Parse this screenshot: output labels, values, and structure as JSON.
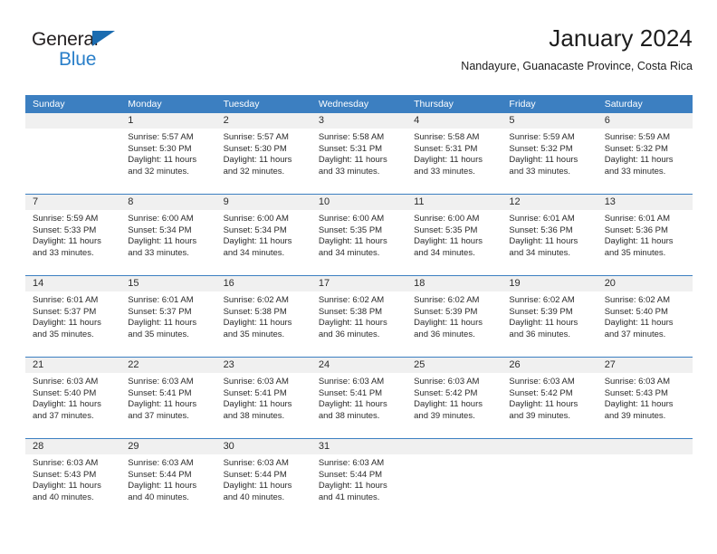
{
  "brand": {
    "name_top": "General",
    "name_bottom": "Blue",
    "triangle_color": "#1b6cb0",
    "text_color": "#231f20",
    "blue_text_color": "#2a7fc9"
  },
  "header": {
    "title": "January 2024",
    "subtitle": "Nandayure, Guanacaste Province, Costa Rica"
  },
  "theme": {
    "header_blue": "#3c7fc1",
    "daynum_band": "#f0f0f0",
    "text": "#2b2b2b",
    "page_background": "#ffffff"
  },
  "calendar": {
    "day_headers": [
      "Sunday",
      "Monday",
      "Tuesday",
      "Wednesday",
      "Thursday",
      "Friday",
      "Saturday"
    ],
    "weeks": [
      [
        {
          "day": "",
          "sunrise": "",
          "sunset": "",
          "daylight_line1": "",
          "daylight_line2": "",
          "empty": true
        },
        {
          "day": "1",
          "sunrise": "Sunrise: 5:57 AM",
          "sunset": "Sunset: 5:30 PM",
          "daylight_line1": "Daylight: 11 hours",
          "daylight_line2": "and 32 minutes."
        },
        {
          "day": "2",
          "sunrise": "Sunrise: 5:57 AM",
          "sunset": "Sunset: 5:30 PM",
          "daylight_line1": "Daylight: 11 hours",
          "daylight_line2": "and 32 minutes."
        },
        {
          "day": "3",
          "sunrise": "Sunrise: 5:58 AM",
          "sunset": "Sunset: 5:31 PM",
          "daylight_line1": "Daylight: 11 hours",
          "daylight_line2": "and 33 minutes."
        },
        {
          "day": "4",
          "sunrise": "Sunrise: 5:58 AM",
          "sunset": "Sunset: 5:31 PM",
          "daylight_line1": "Daylight: 11 hours",
          "daylight_line2": "and 33 minutes."
        },
        {
          "day": "5",
          "sunrise": "Sunrise: 5:59 AM",
          "sunset": "Sunset: 5:32 PM",
          "daylight_line1": "Daylight: 11 hours",
          "daylight_line2": "and 33 minutes."
        },
        {
          "day": "6",
          "sunrise": "Sunrise: 5:59 AM",
          "sunset": "Sunset: 5:32 PM",
          "daylight_line1": "Daylight: 11 hours",
          "daylight_line2": "and 33 minutes."
        }
      ],
      [
        {
          "day": "7",
          "sunrise": "Sunrise: 5:59 AM",
          "sunset": "Sunset: 5:33 PM",
          "daylight_line1": "Daylight: 11 hours",
          "daylight_line2": "and 33 minutes."
        },
        {
          "day": "8",
          "sunrise": "Sunrise: 6:00 AM",
          "sunset": "Sunset: 5:34 PM",
          "daylight_line1": "Daylight: 11 hours",
          "daylight_line2": "and 33 minutes."
        },
        {
          "day": "9",
          "sunrise": "Sunrise: 6:00 AM",
          "sunset": "Sunset: 5:34 PM",
          "daylight_line1": "Daylight: 11 hours",
          "daylight_line2": "and 34 minutes."
        },
        {
          "day": "10",
          "sunrise": "Sunrise: 6:00 AM",
          "sunset": "Sunset: 5:35 PM",
          "daylight_line1": "Daylight: 11 hours",
          "daylight_line2": "and 34 minutes."
        },
        {
          "day": "11",
          "sunrise": "Sunrise: 6:00 AM",
          "sunset": "Sunset: 5:35 PM",
          "daylight_line1": "Daylight: 11 hours",
          "daylight_line2": "and 34 minutes."
        },
        {
          "day": "12",
          "sunrise": "Sunrise: 6:01 AM",
          "sunset": "Sunset: 5:36 PM",
          "daylight_line1": "Daylight: 11 hours",
          "daylight_line2": "and 34 minutes."
        },
        {
          "day": "13",
          "sunrise": "Sunrise: 6:01 AM",
          "sunset": "Sunset: 5:36 PM",
          "daylight_line1": "Daylight: 11 hours",
          "daylight_line2": "and 35 minutes."
        }
      ],
      [
        {
          "day": "14",
          "sunrise": "Sunrise: 6:01 AM",
          "sunset": "Sunset: 5:37 PM",
          "daylight_line1": "Daylight: 11 hours",
          "daylight_line2": "and 35 minutes."
        },
        {
          "day": "15",
          "sunrise": "Sunrise: 6:01 AM",
          "sunset": "Sunset: 5:37 PM",
          "daylight_line1": "Daylight: 11 hours",
          "daylight_line2": "and 35 minutes."
        },
        {
          "day": "16",
          "sunrise": "Sunrise: 6:02 AM",
          "sunset": "Sunset: 5:38 PM",
          "daylight_line1": "Daylight: 11 hours",
          "daylight_line2": "and 35 minutes."
        },
        {
          "day": "17",
          "sunrise": "Sunrise: 6:02 AM",
          "sunset": "Sunset: 5:38 PM",
          "daylight_line1": "Daylight: 11 hours",
          "daylight_line2": "and 36 minutes."
        },
        {
          "day": "18",
          "sunrise": "Sunrise: 6:02 AM",
          "sunset": "Sunset: 5:39 PM",
          "daylight_line1": "Daylight: 11 hours",
          "daylight_line2": "and 36 minutes."
        },
        {
          "day": "19",
          "sunrise": "Sunrise: 6:02 AM",
          "sunset": "Sunset: 5:39 PM",
          "daylight_line1": "Daylight: 11 hours",
          "daylight_line2": "and 36 minutes."
        },
        {
          "day": "20",
          "sunrise": "Sunrise: 6:02 AM",
          "sunset": "Sunset: 5:40 PM",
          "daylight_line1": "Daylight: 11 hours",
          "daylight_line2": "and 37 minutes."
        }
      ],
      [
        {
          "day": "21",
          "sunrise": "Sunrise: 6:03 AM",
          "sunset": "Sunset: 5:40 PM",
          "daylight_line1": "Daylight: 11 hours",
          "daylight_line2": "and 37 minutes."
        },
        {
          "day": "22",
          "sunrise": "Sunrise: 6:03 AM",
          "sunset": "Sunset: 5:41 PM",
          "daylight_line1": "Daylight: 11 hours",
          "daylight_line2": "and 37 minutes."
        },
        {
          "day": "23",
          "sunrise": "Sunrise: 6:03 AM",
          "sunset": "Sunset: 5:41 PM",
          "daylight_line1": "Daylight: 11 hours",
          "daylight_line2": "and 38 minutes."
        },
        {
          "day": "24",
          "sunrise": "Sunrise: 6:03 AM",
          "sunset": "Sunset: 5:41 PM",
          "daylight_line1": "Daylight: 11 hours",
          "daylight_line2": "and 38 minutes."
        },
        {
          "day": "25",
          "sunrise": "Sunrise: 6:03 AM",
          "sunset": "Sunset: 5:42 PM",
          "daylight_line1": "Daylight: 11 hours",
          "daylight_line2": "and 39 minutes."
        },
        {
          "day": "26",
          "sunrise": "Sunrise: 6:03 AM",
          "sunset": "Sunset: 5:42 PM",
          "daylight_line1": "Daylight: 11 hours",
          "daylight_line2": "and 39 minutes."
        },
        {
          "day": "27",
          "sunrise": "Sunrise: 6:03 AM",
          "sunset": "Sunset: 5:43 PM",
          "daylight_line1": "Daylight: 11 hours",
          "daylight_line2": "and 39 minutes."
        }
      ],
      [
        {
          "day": "28",
          "sunrise": "Sunrise: 6:03 AM",
          "sunset": "Sunset: 5:43 PM",
          "daylight_line1": "Daylight: 11 hours",
          "daylight_line2": "and 40 minutes."
        },
        {
          "day": "29",
          "sunrise": "Sunrise: 6:03 AM",
          "sunset": "Sunset: 5:44 PM",
          "daylight_line1": "Daylight: 11 hours",
          "daylight_line2": "and 40 minutes."
        },
        {
          "day": "30",
          "sunrise": "Sunrise: 6:03 AM",
          "sunset": "Sunset: 5:44 PM",
          "daylight_line1": "Daylight: 11 hours",
          "daylight_line2": "and 40 minutes."
        },
        {
          "day": "31",
          "sunrise": "Sunrise: 6:03 AM",
          "sunset": "Sunset: 5:44 PM",
          "daylight_line1": "Daylight: 11 hours",
          "daylight_line2": "and 41 minutes."
        },
        {
          "day": "",
          "sunrise": "",
          "sunset": "",
          "daylight_line1": "",
          "daylight_line2": "",
          "empty": true
        },
        {
          "day": "",
          "sunrise": "",
          "sunset": "",
          "daylight_line1": "",
          "daylight_line2": "",
          "empty": true
        },
        {
          "day": "",
          "sunrise": "",
          "sunset": "",
          "daylight_line1": "",
          "daylight_line2": "",
          "empty": true
        }
      ]
    ]
  }
}
